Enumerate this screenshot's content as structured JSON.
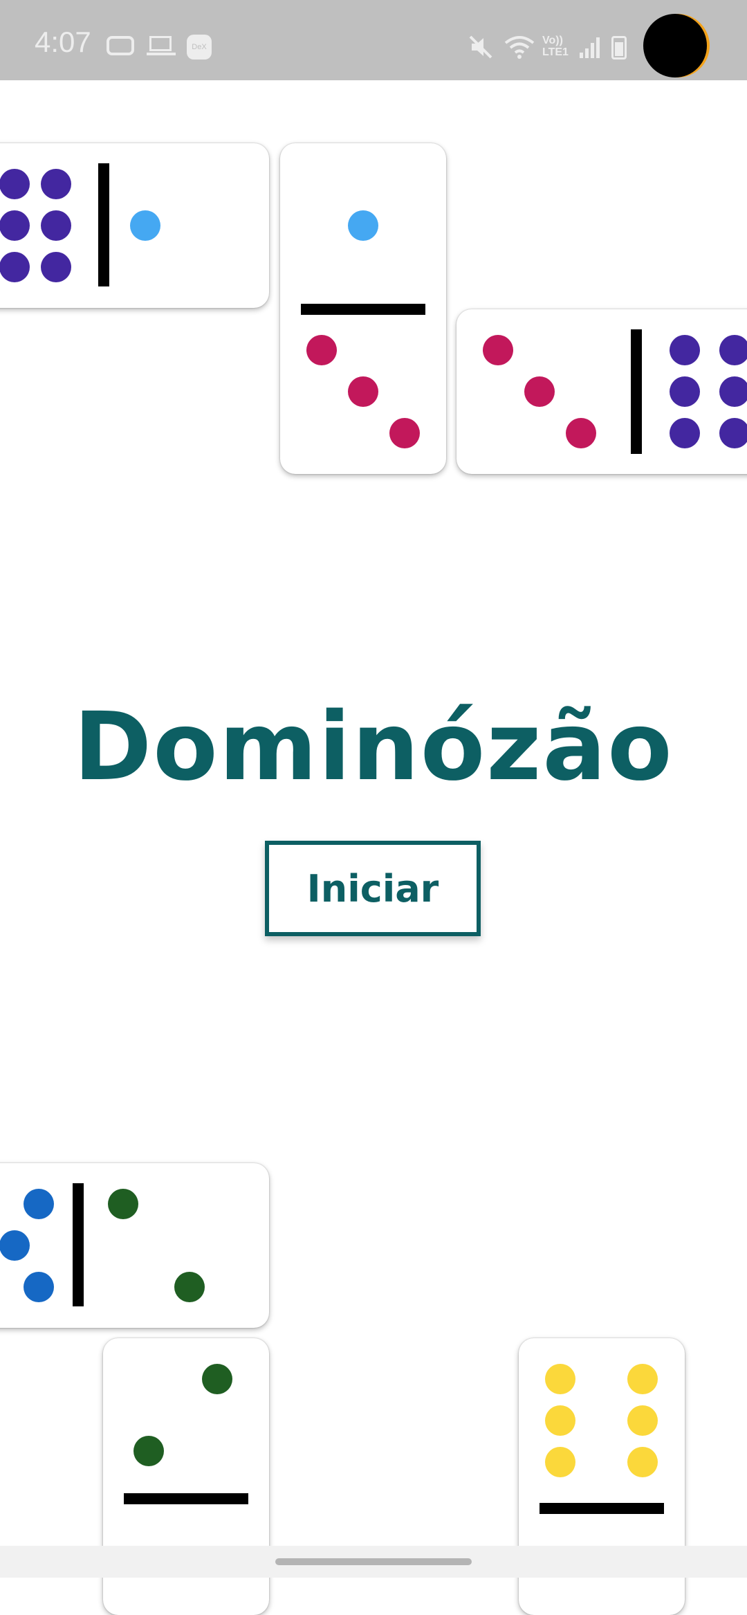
{
  "status_bar": {
    "time": "4:07",
    "dex_label": "DeX",
    "volte_label": "Vo))\nLTE1",
    "icons": [
      "voicemail-icon",
      "laptop-icon",
      "dex-icon",
      "mute-icon",
      "wifi-icon",
      "volte-icon",
      "signal-icon",
      "battery-icon"
    ]
  },
  "app": {
    "title": "Dominózão",
    "start_button": "Iniciar"
  },
  "colors": {
    "title": "#0d5f63",
    "pip_purple": "#4327a0",
    "pip_lightblue": "#45a8f2",
    "pip_crimson": "#c2185b",
    "pip_blue": "#1668c4",
    "pip_green": "#1f5e22",
    "pip_yellow": "#fbd83b"
  },
  "dominoes": [
    {
      "name": "domino-6-1",
      "values": [
        6,
        1
      ]
    },
    {
      "name": "domino-1-3",
      "values": [
        1,
        3
      ]
    },
    {
      "name": "domino-3-6",
      "values": [
        3,
        6
      ]
    },
    {
      "name": "domino-3-2",
      "values": [
        3,
        2
      ]
    },
    {
      "name": "domino-2-0",
      "values": [
        2,
        0
      ]
    },
    {
      "name": "domino-6-0",
      "values": [
        6,
        0
      ]
    }
  ]
}
